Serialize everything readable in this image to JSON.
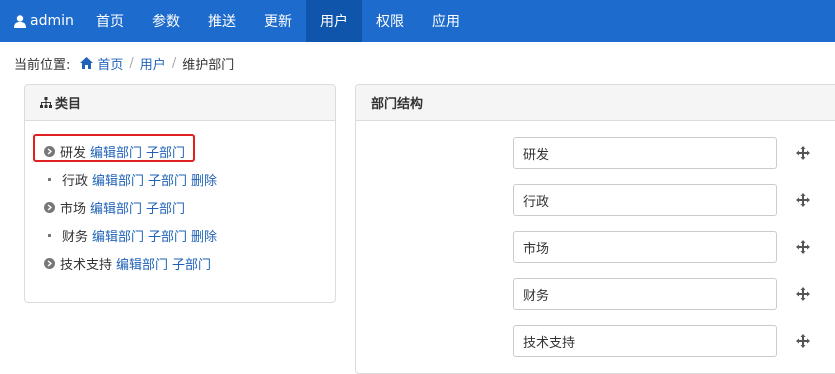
{
  "topnav": {
    "user": "admin",
    "items": [
      {
        "label": "首页",
        "active": false
      },
      {
        "label": "参数",
        "active": false
      },
      {
        "label": "推送",
        "active": false
      },
      {
        "label": "更新",
        "active": false
      },
      {
        "label": "用户",
        "active": true
      },
      {
        "label": "权限",
        "active": false
      },
      {
        "label": "应用",
        "active": false
      }
    ],
    "colors": {
      "bar": "#1d6bcc",
      "active": "#0f55ab"
    }
  },
  "breadcrumb": {
    "prefix": "当前位置:",
    "home": "首页",
    "users": "用户",
    "current": "维护部门"
  },
  "left_panel": {
    "title": "类目",
    "tree": [
      {
        "name": "研发",
        "edit": "编辑部门",
        "child": "子部门",
        "delete": "",
        "has_children": true
      },
      {
        "name": "行政",
        "edit": "编辑部门",
        "child": "子部门",
        "delete": "删除",
        "has_children": false
      },
      {
        "name": "市场",
        "edit": "编辑部门",
        "child": "子部门",
        "delete": "",
        "has_children": true
      },
      {
        "name": "财务",
        "edit": "编辑部门",
        "child": "子部门",
        "delete": "删除",
        "has_children": false
      },
      {
        "name": "技术支持",
        "edit": "编辑部门",
        "child": "子部门",
        "delete": "",
        "has_children": true
      }
    ]
  },
  "right_panel": {
    "title": "部门结构",
    "inputs": [
      "研发",
      "行政",
      "市场",
      "财务",
      "技术支持"
    ]
  }
}
